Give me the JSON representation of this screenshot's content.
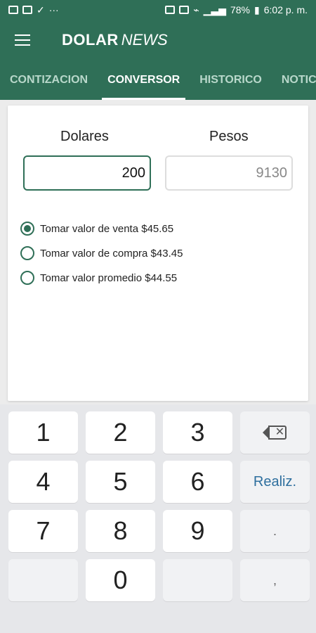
{
  "status_bar": {
    "left_more": "···",
    "battery": "78%",
    "time": "6:02 p. m."
  },
  "app": {
    "brand_bold": "DOLAR",
    "brand_italic": "NEWS"
  },
  "tabs": [
    {
      "label": "CONTIZACION",
      "active": false
    },
    {
      "label": "CONVERSOR",
      "active": true
    },
    {
      "label": "HISTORICO",
      "active": false
    },
    {
      "label": "NOTICIA",
      "active": false
    }
  ],
  "converter": {
    "dolares_label": "Dolares",
    "pesos_label": "Pesos",
    "dolares_value": "200",
    "pesos_value": "9130",
    "options": [
      {
        "label": "Tomar valor de venta $45.65",
        "checked": true
      },
      {
        "label": "Tomar valor de compra $43.45",
        "checked": false
      },
      {
        "label": "Tomar valor promedio $44.55",
        "checked": false
      }
    ]
  },
  "keyboard": {
    "keys": [
      "1",
      "2",
      "3",
      "4",
      "5",
      "6",
      "7",
      "8",
      "9",
      "0"
    ],
    "realiz_label": "Realiz.",
    "dot_label": ".",
    "comma_label": ","
  },
  "colors": {
    "primary": "#2f6f57",
    "tab_inactive": "#b9d8cb",
    "accent_blue": "#2e6f9e"
  },
  "icons": {
    "status_left": [
      "image-icon",
      "briefcase-icon",
      "twitter-icon"
    ],
    "status_right": [
      "vibrate-icon",
      "nfc-icon",
      "wifi-icon",
      "signal-icon",
      "battery-icon"
    ],
    "menu": "hamburger-menu-icon",
    "backspace": "backspace-icon"
  }
}
